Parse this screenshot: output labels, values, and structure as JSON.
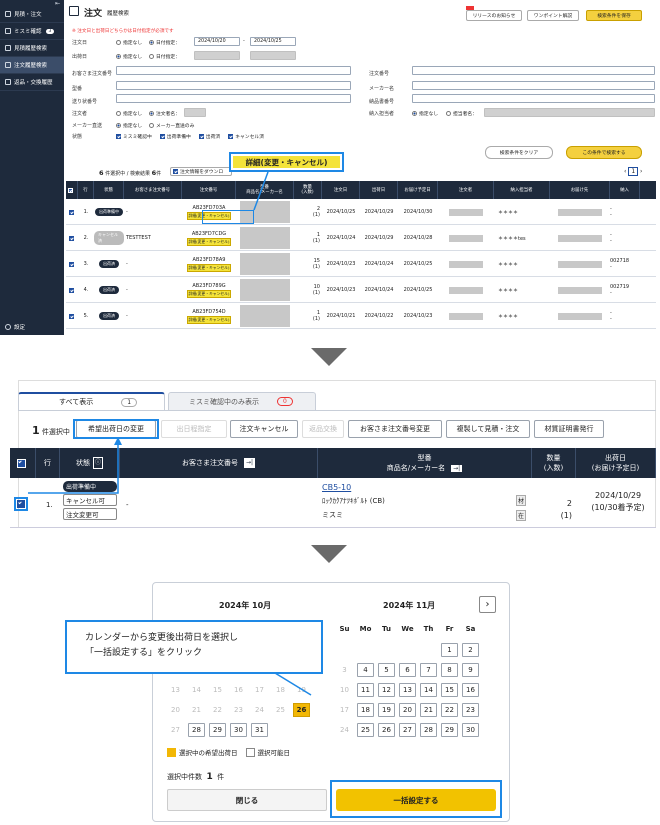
{
  "panel1": {
    "sidebar": {
      "items": [
        {
          "label": "見積・注文",
          "badge": ""
        },
        {
          "label": "ミスミ確認",
          "badge": "3"
        },
        {
          "label": "見積履歴検索",
          "badge": ""
        },
        {
          "label": "注文履歴検索",
          "badge": ""
        },
        {
          "label": "返品・交換履歴",
          "badge": ""
        }
      ],
      "settings_label": "設定"
    },
    "header": {
      "title": "注文",
      "subtitle": "履歴検索",
      "release_btn": "リリースのお知らせ",
      "onepoint_btn": "ワンポイント解説",
      "save_btn": "検索条件を保存",
      "note": "※ 注文日と出荷日どちらかは日付指定が必須です"
    },
    "search": {
      "order_date_label": "注文日",
      "ship_date_label": "出荷日",
      "no_spec": "指定なし",
      "date_spec": "日付指定：",
      "order_from": "2024/10/20",
      "order_to": "2024/10/25",
      "customer_order_label": "お客さま注文番号",
      "model_label": "型番",
      "tracking_label": "送り状番号",
      "orderer_label": "注文者",
      "orderer_opt": "注文者名：",
      "maker_direct_label": "メーカー直送",
      "maker_opt": "メーカー直送のみ",
      "status_label": "状態",
      "statuses": [
        "ミスミ確認中",
        "出荷準備中",
        "出荷済",
        "キャンセル済"
      ],
      "order_no_label": "注文番号",
      "maker_name_label": "メーカー名",
      "delivery_no_label": "納品書番号",
      "receiver_label": "納入担当者",
      "receiver_opt": "担当者名：",
      "clear_btn": "検索条件をクリア",
      "search_btn": "この条件で検索する"
    },
    "table_bar": {
      "selected_prefix": "6",
      "selected_text": "件選択中 / 検索結果",
      "result_count": "6",
      "result_suffix": "件",
      "download_btn": "注文情報をダウンロ",
      "page": "1"
    },
    "callout": "詳細(変更・キャンセル)",
    "columns": [
      "行",
      "状態",
      "お客さま注文番号",
      "注文番号",
      "型番\n商品名/メーカー名",
      "数量\n(入数)",
      "注文日",
      "出荷日",
      "お届け予定日",
      "注文者",
      "納入担当者",
      "お届け先",
      "納入"
    ],
    "rows": [
      {
        "no": "1.",
        "status": "出荷準備中",
        "status_gray": false,
        "cust_no": "-",
        "order_no": "AB23FD703A",
        "detail": "詳細(変更・キャンセル)",
        "qty": "2",
        "qty2": "(1)",
        "order_date": "2024/10/25",
        "ship_date": "2024/10/29",
        "eta": "2024/10/30",
        "receiver": "＊＊＊＊",
        "extra": "-\n-"
      },
      {
        "no": "2.",
        "status": "キャンセル済",
        "status_gray": true,
        "cust_no": "TESTTEST",
        "order_no": "AB23FD7CDG",
        "detail": "詳細(変更・キャンセル)",
        "qty": "1",
        "qty2": "(1)",
        "order_date": "2024/10/24",
        "ship_date": "2024/10/29",
        "eta": "2024/10/28",
        "receiver": "＊＊＊＊tes",
        "extra": "-\n-"
      },
      {
        "no": "3.",
        "status": "出荷済",
        "status_gray": false,
        "cust_no": "-",
        "order_no": "AB23FD78A9",
        "detail": "詳細(変更・キャンセル)",
        "qty": "15",
        "qty2": "(1)",
        "order_date": "2024/10/23",
        "ship_date": "2024/10/24",
        "eta": "2024/10/25",
        "receiver": "＊＊＊＊",
        "extra": "002718\n-"
      },
      {
        "no": "4.",
        "status": "出荷済",
        "status_gray": false,
        "cust_no": "-",
        "order_no": "AB23FD789G",
        "detail": "詳細(変更・キャンセル)",
        "qty": "10",
        "qty2": "(1)",
        "order_date": "2024/10/23",
        "ship_date": "2024/10/24",
        "eta": "2024/10/25",
        "receiver": "＊＊＊＊",
        "extra": "002719\n-"
      },
      {
        "no": "5.",
        "status": "出荷済",
        "status_gray": false,
        "cust_no": "-",
        "order_no": "AB23FD754D",
        "detail": "詳細(変更・キャンセル)",
        "qty": "1",
        "qty2": "(1)",
        "order_date": "2024/10/21",
        "ship_date": "2024/10/22",
        "eta": "2024/10/23",
        "receiver": "＊＊＊＊",
        "extra": "-\n-"
      }
    ]
  },
  "panel2": {
    "tab_all": "すべて表示",
    "tab_all_count": "1",
    "tab_misumi": "ミスミ確認中のみ表示",
    "tab_misumi_count": "0",
    "selected_count": "1",
    "selected_text": "件選択中",
    "buttons": [
      {
        "label": "希望出荷日の変更",
        "disabled": false
      },
      {
        "label": "出日程指定",
        "disabled": true
      },
      {
        "label": "注文キャンセル",
        "disabled": false
      },
      {
        "label": "返品交換",
        "disabled": true
      },
      {
        "label": "お客さま注文番号変更",
        "disabled": false
      },
      {
        "label": "複製して見積・注文",
        "disabled": false
      },
      {
        "label": "材質証明書発行",
        "disabled": false
      }
    ],
    "col_row": "行",
    "col_status": "状態",
    "col_cust": "お客さま注文番号",
    "col_model": "型番",
    "col_model2": "商品名/メーカー名",
    "col_qty": "数量",
    "col_qty2": "(入数)",
    "col_ship": "出荷日",
    "col_ship2": "(お届け予定日)",
    "row": {
      "no": "1.",
      "status": "出荷準備中",
      "cancel": "キャンセル可",
      "change": "注文変更可",
      "cust": "-",
      "model": "CB5-10",
      "product": "ﾛｯｸｶｸｱﾅﾂｷﾎﾞﾙﾄ (CB)",
      "maker": "ミスミ",
      "mat1": "材",
      "mat2": "在",
      "qty": "2",
      "qty2": "(1)",
      "ship": "2024/10/29",
      "eta": "(10/30着予定)"
    }
  },
  "panel3": {
    "month1": "2024年 10月",
    "month2": "2024年 11月",
    "next_icon": "chevron-right-icon",
    "dow": [
      "Su",
      "Mo",
      "Tu",
      "We",
      "Th",
      "Fr",
      "Sa"
    ],
    "callout_line1": "カレンダーから変更後出荷日を選択し",
    "callout_line2": "「一括設定する」をクリック",
    "legend_selected": "選択中の希望出荷日",
    "legend_available": "選択可能日",
    "count_label": "選択中件数",
    "count_value": "1",
    "count_unit": "件",
    "close_btn": "閉じる",
    "apply_btn": "一括設定する",
    "accent": "#f2b705"
  }
}
